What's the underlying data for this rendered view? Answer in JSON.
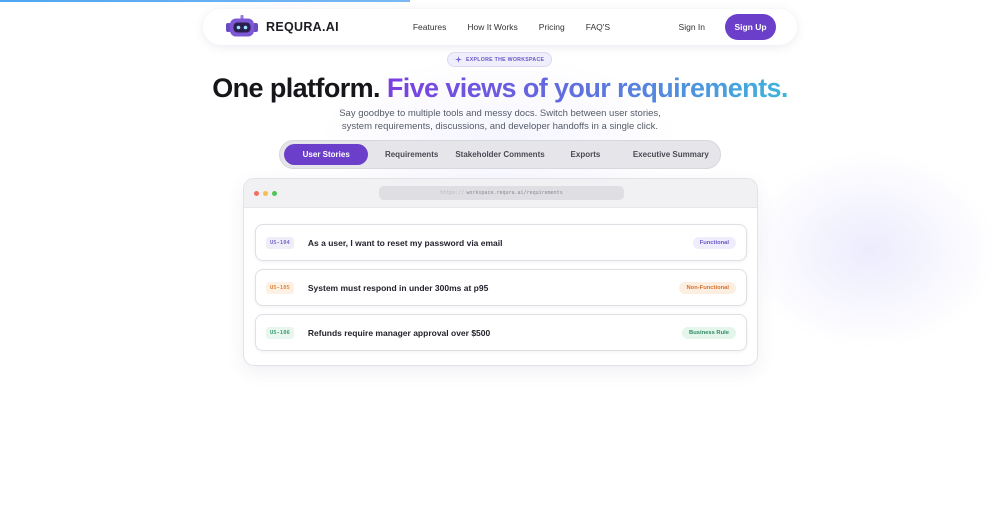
{
  "brand": {
    "name": "REQURA",
    "suffix": ".AI"
  },
  "nav": {
    "links": [
      "Features",
      "How It Works",
      "Pricing",
      "FAQ'S"
    ],
    "sign_in": "Sign In",
    "sign_up": "Sign Up"
  },
  "hero": {
    "badge": "EXPLORE THE WORKSPACE",
    "headline_part1": "One platform.",
    "headline_part2": "Five views of your requirements.",
    "subtitle_line1": "Say goodbye to multiple tools and messy docs. Switch between user stories,",
    "subtitle_line2": "system requirements, discussions, and developer handoffs in a single click."
  },
  "tabs": [
    "User Stories",
    "Requirements",
    "Stakeholder Comments",
    "Exports",
    "Executive Summary"
  ],
  "active_tab": "User Stories",
  "window": {
    "url_scheme": "https://",
    "url_path": "workspace.requra.ai/requirements",
    "dot_colors": [
      "#f26d62",
      "#f6be4f",
      "#52c45a"
    ]
  },
  "rows": [
    {
      "id": "US-104",
      "text": "As a user, I want to reset my password via email",
      "tag": "Functional",
      "id_color": "#7b6fc9",
      "id_bg": "#eeedf8",
      "tag_color": "#6a55c8",
      "tag_bg": "#efedfb"
    },
    {
      "id": "US-105",
      "text": "System must respond in under 300ms at p95",
      "tag": "Non-Functional",
      "id_color": "#e5853a",
      "id_bg": "#fdf1e6",
      "tag_color": "#d6702c",
      "tag_bg": "#fdeee2"
    },
    {
      "id": "US-106",
      "text": "Refunds require manager approval over $500",
      "tag": "Business Rule",
      "id_color": "#3b9e74",
      "id_bg": "#e8f6ef",
      "tag_color": "#2f8a63",
      "tag_bg": "#e4f5ec"
    }
  ],
  "colors": {
    "accent": "#6b3fc9"
  }
}
